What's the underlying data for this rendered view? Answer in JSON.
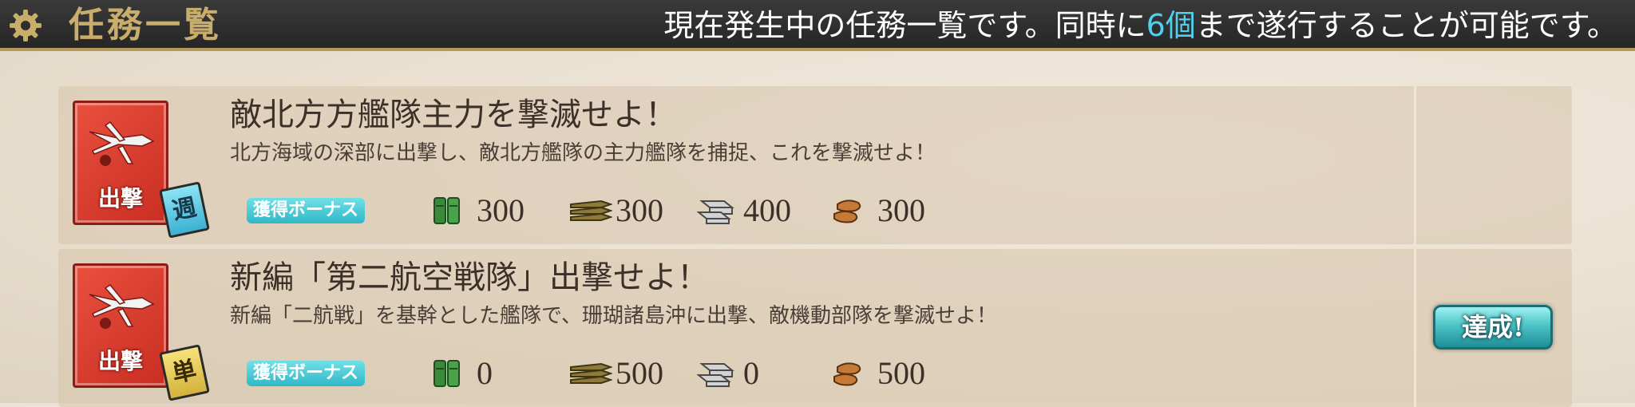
{
  "header": {
    "title": "任務一覧",
    "notice_before": "現在発生中の任務一覧です。同時に",
    "notice_highlight": "6個",
    "notice_after": "まで遂行することが可能です。"
  },
  "bonus_label": "獲得ボーナス",
  "quests": [
    {
      "category": "出撃",
      "category_color": "#d93c2e",
      "frequency": "週",
      "title": "敵北方方艦隊主力を撃滅せよ！",
      "description": "北方海域の深部に出撃し、敵北方艦隊の主力艦隊を捕捉、これを撃滅せよ！",
      "rewards": {
        "fuel": "300",
        "ammo": "300",
        "steel": "400",
        "bauxite": "300"
      },
      "achieved_label": ""
    },
    {
      "category": "出撃",
      "category_color": "#d93c2e",
      "frequency": "単",
      "title": "新編「第二航空戦隊」出撃せよ！",
      "description": "新編「二航戦」を基幹とした艦隊で、珊瑚諸島沖に出撃、敵機動部隊を撃滅せよ！",
      "rewards": {
        "fuel": "0",
        "ammo": "500",
        "steel": "0",
        "bauxite": "500"
      },
      "achieved_label": "達成!"
    }
  ]
}
